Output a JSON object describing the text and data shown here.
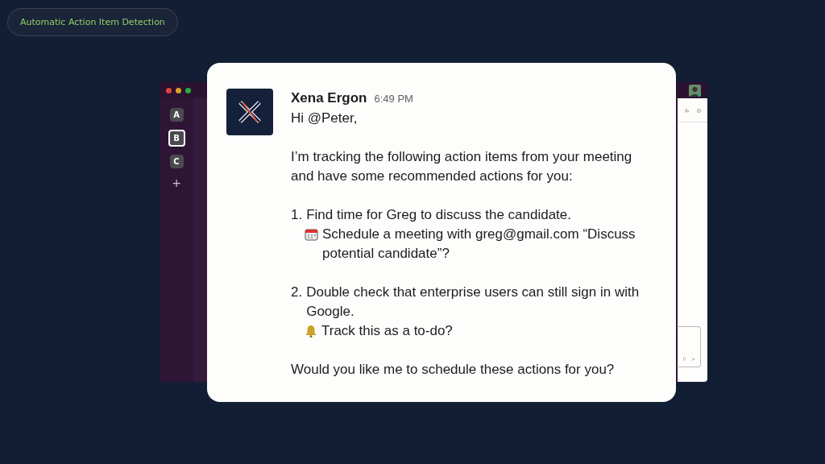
{
  "badge": {
    "label": "Automatic Action Item Detection"
  },
  "workspaces": [
    {
      "label": "A",
      "selected": false
    },
    {
      "label": "B",
      "selected": true
    },
    {
      "label": "C",
      "selected": false
    }
  ],
  "add_workspace": "+",
  "message": {
    "sender": "Xena Ergon",
    "time": "6:49 PM",
    "greeting": "Hi @Peter,",
    "intro": "I’m tracking the following action items from your meeting and have some recommended actions for you:",
    "items": [
      {
        "number": "1.",
        "text": "Find time for Greg to discuss the candidate.",
        "suggestion": {
          "kind": "calendar",
          "text": "Schedule a meeting with greg@gmail.com “Discuss potential candidate”?"
        }
      },
      {
        "number": "2.",
        "text": "Double check that enterprise users can still sign in with Google.",
        "suggestion": {
          "kind": "bell",
          "text": "Track this as a to-do?"
        }
      }
    ],
    "closing": "Would you like me to schedule these actions for you?"
  }
}
